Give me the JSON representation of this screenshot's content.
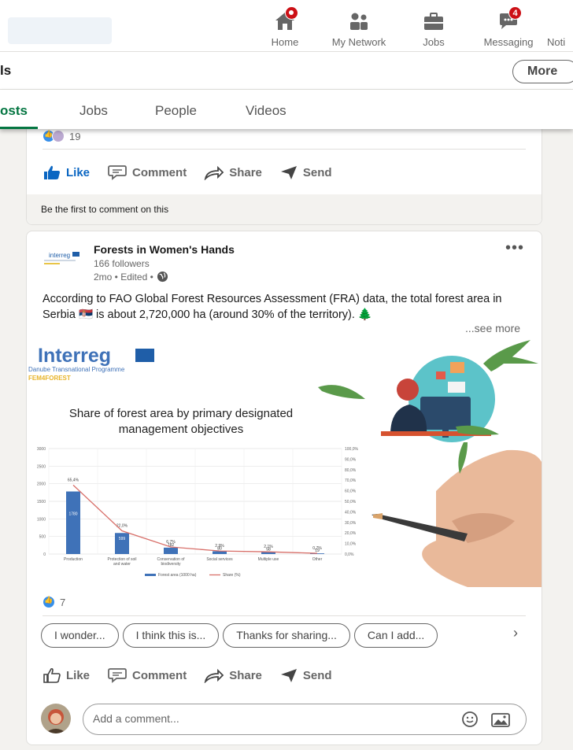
{
  "nav": {
    "items": [
      {
        "label": "Home",
        "icon": "home-icon",
        "badge": ""
      },
      {
        "label": "My Network",
        "icon": "network-icon",
        "badge": ""
      },
      {
        "label": "Jobs",
        "icon": "briefcase-icon",
        "badge": ""
      },
      {
        "label": "Messaging",
        "icon": "messaging-icon",
        "badge": "4"
      },
      {
        "label": "Noti",
        "icon": "bell-icon",
        "badge": ""
      }
    ]
  },
  "subheader": {
    "title": "ls",
    "more_label": "More"
  },
  "tabs": [
    {
      "label": "osts",
      "active": true
    },
    {
      "label": "Jobs",
      "active": false
    },
    {
      "label": "People",
      "active": false
    },
    {
      "label": "Videos",
      "active": false
    }
  ],
  "post1": {
    "reaction_count": "19",
    "actions": {
      "like": "Like",
      "comment": "Comment",
      "share": "Share",
      "send": "Send"
    },
    "first_comment": "Be the first to comment on this"
  },
  "post2": {
    "org_name": "Forests in Women's Hands",
    "followers": "166 followers",
    "meta": "2mo • Edited •",
    "text": "According to FAO Global Forest Resources Assessment (FRA) data, the total forest area in Serbia 🇷🇸 is about 2,720,000 ha (around 30% of the territory). 🌲",
    "see_more": "...see more",
    "image": {
      "brand": "Interreg",
      "programme": "Danube Transnational Programme",
      "project": "FEM4FOREST",
      "logo_text": "interreg",
      "chart_title_line1": "Share of forest area by primary designated",
      "chart_title_line2": "management objectives"
    },
    "reaction_count": "7",
    "suggestions": [
      "I wonder...",
      "I think this is...",
      "Thanks for sharing...",
      "Can I add..."
    ],
    "actions": {
      "like": "Like",
      "comment": "Comment",
      "share": "Share",
      "send": "Send"
    },
    "comment_placeholder": "Add a comment..."
  },
  "chart_data": {
    "type": "bar",
    "title": "Share of forest area by primary designated management objectives",
    "categories": [
      "Production",
      "Protection of soil and water",
      "Conservation of biodiversity",
      "Social services",
      "Multiple use",
      "Other"
    ],
    "series": [
      {
        "name": "Forest area (1000 ha)",
        "type": "bar",
        "values": [
          1780,
          599,
          182,
          80,
          58,
          19
        ],
        "axis": "left"
      },
      {
        "name": "Share (%)",
        "type": "line",
        "values": [
          65.4,
          22.0,
          6.7,
          2.9,
          2.1,
          0.7
        ],
        "axis": "right"
      }
    ],
    "bar_labels": [
      "1780",
      "599",
      "182",
      "80",
      "58",
      "19"
    ],
    "line_labels": [
      "65,4%",
      "22,0%",
      "6,7%",
      "2,9%",
      "2,1%",
      "0,7%"
    ],
    "y_ticks": [
      "0",
      "500",
      "1000",
      "1500",
      "2000",
      "2500",
      "3000"
    ],
    "y2_ticks": [
      "0,0%",
      "10,0%",
      "20,0%",
      "30,0%",
      "40,0%",
      "50,0%",
      "60,0%",
      "70,0%",
      "80,0%",
      "90,0%",
      "100,0%"
    ],
    "ylim": [
      0,
      3000
    ],
    "y2lim": [
      0,
      100
    ],
    "grid": true,
    "legend": "bottom",
    "colors": {
      "bar": "#3f72b8",
      "line": "#d8706a"
    }
  },
  "colors": {
    "accent": "#0a66c2",
    "tab_active": "#057642",
    "badge": "#cc1016"
  }
}
